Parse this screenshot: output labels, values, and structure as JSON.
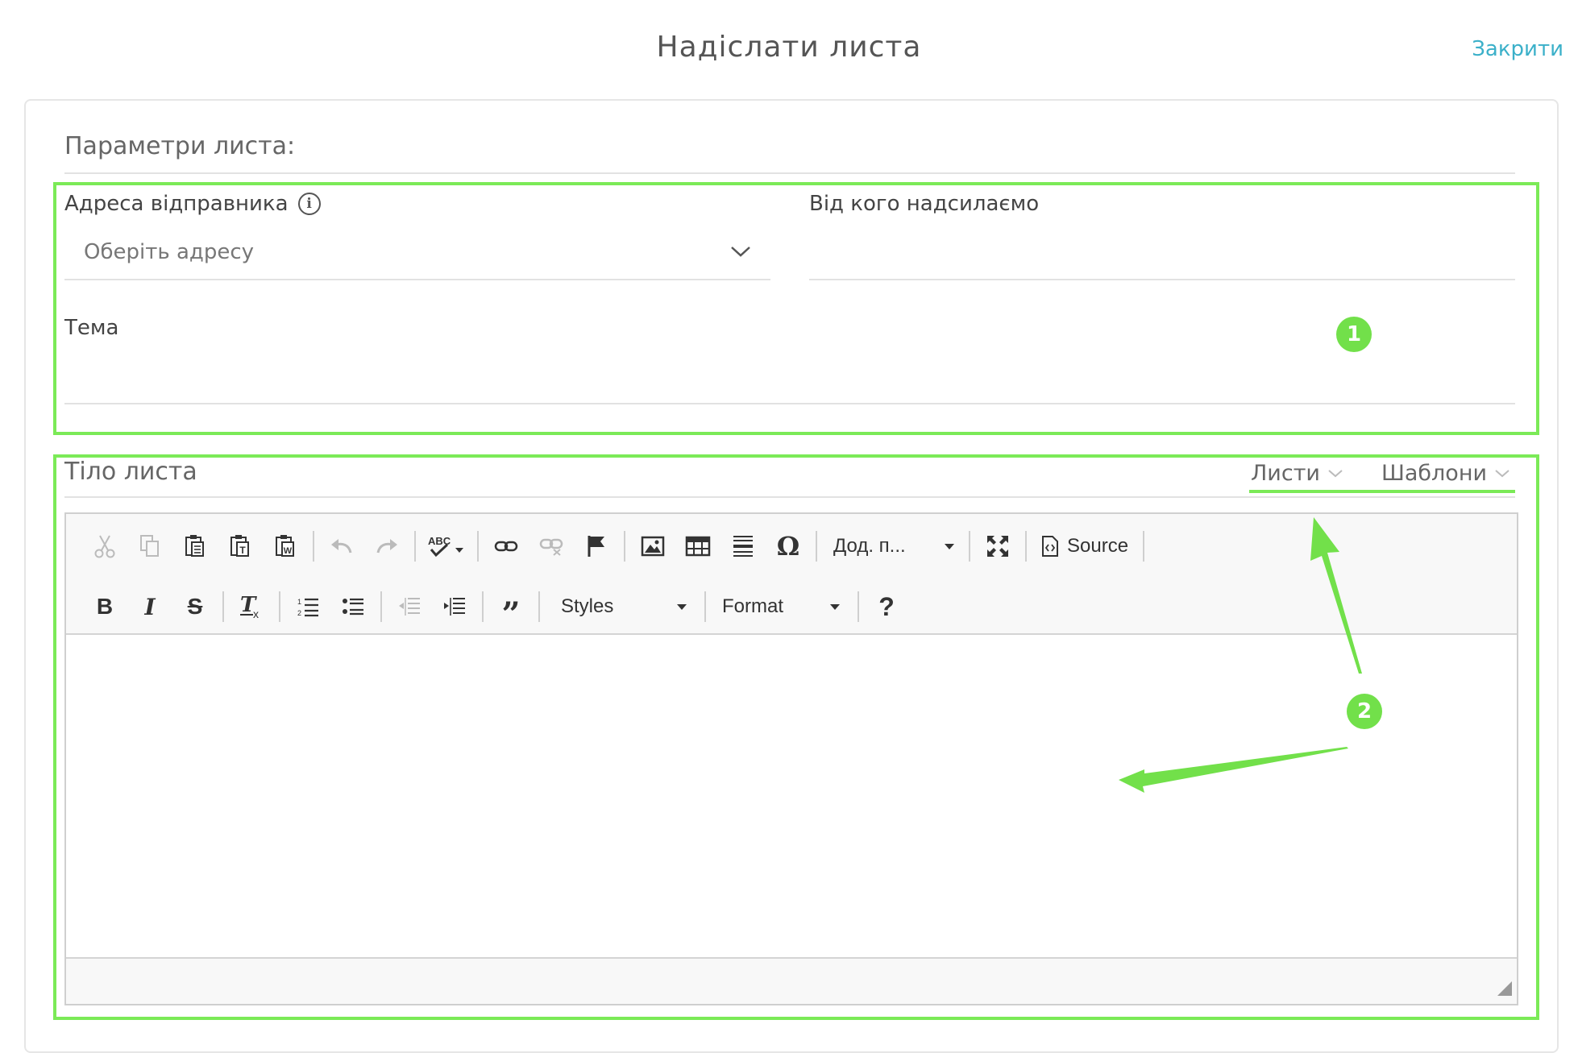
{
  "dialog": {
    "title": "Надіслати листа",
    "close_label": "Закрити"
  },
  "params": {
    "heading": "Параметри листа:",
    "sender_address": {
      "label": "Адреса відправника",
      "placeholder": "Оберіть адресу"
    },
    "from_name": {
      "label": "Від кого надсилаємо",
      "value": ""
    },
    "subject": {
      "label": "Тема",
      "value": ""
    }
  },
  "body": {
    "heading": "Тіло листа",
    "tabs": [
      {
        "label": "Листи"
      },
      {
        "label": "Шаблони"
      }
    ]
  },
  "toolbar": {
    "row1": {
      "extra_label": "Дод. п...",
      "source_label": "Source"
    },
    "row2": {
      "styles_label": "Styles",
      "format_label": "Format",
      "help_label": "?"
    },
    "icons": [
      "cut-icon",
      "copy-icon",
      "paste-icon",
      "paste-text-icon",
      "paste-word-icon",
      "undo-icon",
      "redo-icon",
      "spellcheck-icon",
      "link-icon",
      "unlink-icon",
      "anchor-icon",
      "image-icon",
      "table-icon",
      "horizontal-line-icon",
      "special-char-icon",
      "maximize-icon",
      "source-icon",
      "bold-icon",
      "italic-icon",
      "strike-icon",
      "remove-format-icon",
      "numbered-list-icon",
      "bulleted-list-icon",
      "outdent-icon",
      "indent-icon",
      "blockquote-icon"
    ]
  },
  "annotations": {
    "badge1": "1",
    "badge2": "2",
    "color": "#72e04a"
  }
}
